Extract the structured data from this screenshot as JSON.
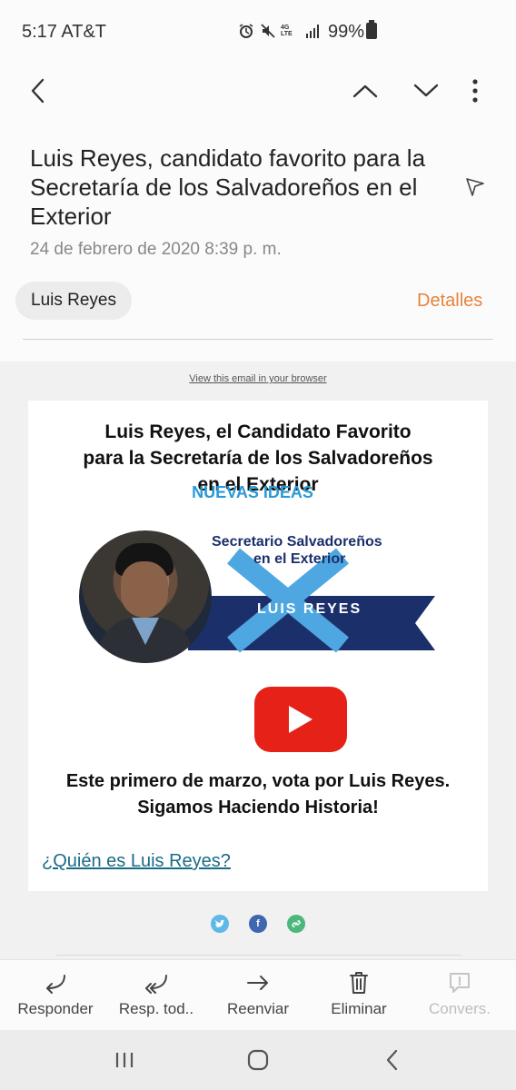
{
  "status": {
    "time": "5:17 AT&T",
    "network": "4G LTE",
    "battery": "99%"
  },
  "toolbar": {
    "back_icon": "chevron-left-icon",
    "prev_icon": "chevron-up-icon",
    "next_icon": "chevron-down-icon",
    "more_icon": "more-vertical-icon"
  },
  "email": {
    "subject": "Luis Reyes, candidato favorito para la Secretaría de los Salvadoreños en el Exterior",
    "date": "24 de febrero de 2020  8:39 p. m.",
    "sender": "Luis Reyes",
    "details_label": "Detalles"
  },
  "body": {
    "view_in_browser": "View this email in your browser",
    "title_lines": [
      "Luis Reyes, el Candidato Favorito",
      "para la Secretaría de los Salvadoreños",
      "en el Exterior"
    ],
    "party": "NUEVAS IDEAS",
    "banner_line1": "Secretario Salvadoreños",
    "banner_line2": "en el Exterior",
    "banner_name": "LUIS REYES",
    "cta_line1": "Este primero de marzo, vota por Luis Reyes.",
    "cta_line2": "Sigamos Haciendo Historia!",
    "who_link": "¿Quién es Luis Reyes?"
  },
  "actions": [
    {
      "label": "Responder",
      "icon": "reply-icon"
    },
    {
      "label": "Resp. tod..",
      "icon": "reply-all-icon"
    },
    {
      "label": "Reenviar",
      "icon": "forward-icon"
    },
    {
      "label": "Eliminar",
      "icon": "trash-icon"
    },
    {
      "label": "Convers.",
      "icon": "conversation-icon"
    }
  ],
  "colors": {
    "accent": "#e8833a",
    "party_blue": "#2a9ad6",
    "banner_navy": "#1b2f6b",
    "link": "#1a6b86",
    "youtube_red": "#e62117"
  }
}
